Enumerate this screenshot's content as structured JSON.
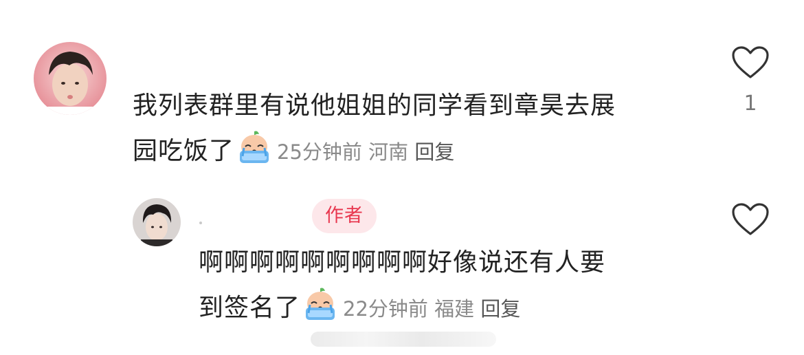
{
  "comments": [
    {
      "avatar_icon": "user-avatar-icon",
      "text_line1": "我列表群里有说他姐姐的同学看到章昊去展",
      "text_line2": "园吃饭了",
      "sticker_icon": "crying-sticker-icon",
      "time": "25分钟前",
      "location": "河南",
      "reply_label": "回复",
      "like_icon": "heart-icon",
      "like_count": "1"
    },
    {
      "avatar_icon": "author-avatar-icon",
      "badge": "作者",
      "text_line1": "啊啊啊啊啊啊啊啊啊好像说还有人要",
      "text_line2": "到签名了",
      "sticker_icon": "crying-sticker-icon",
      "time": "22分钟前",
      "location": "福建",
      "reply_label": "回复",
      "like_icon": "heart-icon"
    }
  ],
  "colors": {
    "badge_bg": "#fde7ea",
    "badge_text": "#e8374f",
    "meta_text": "#8a8a8a"
  }
}
